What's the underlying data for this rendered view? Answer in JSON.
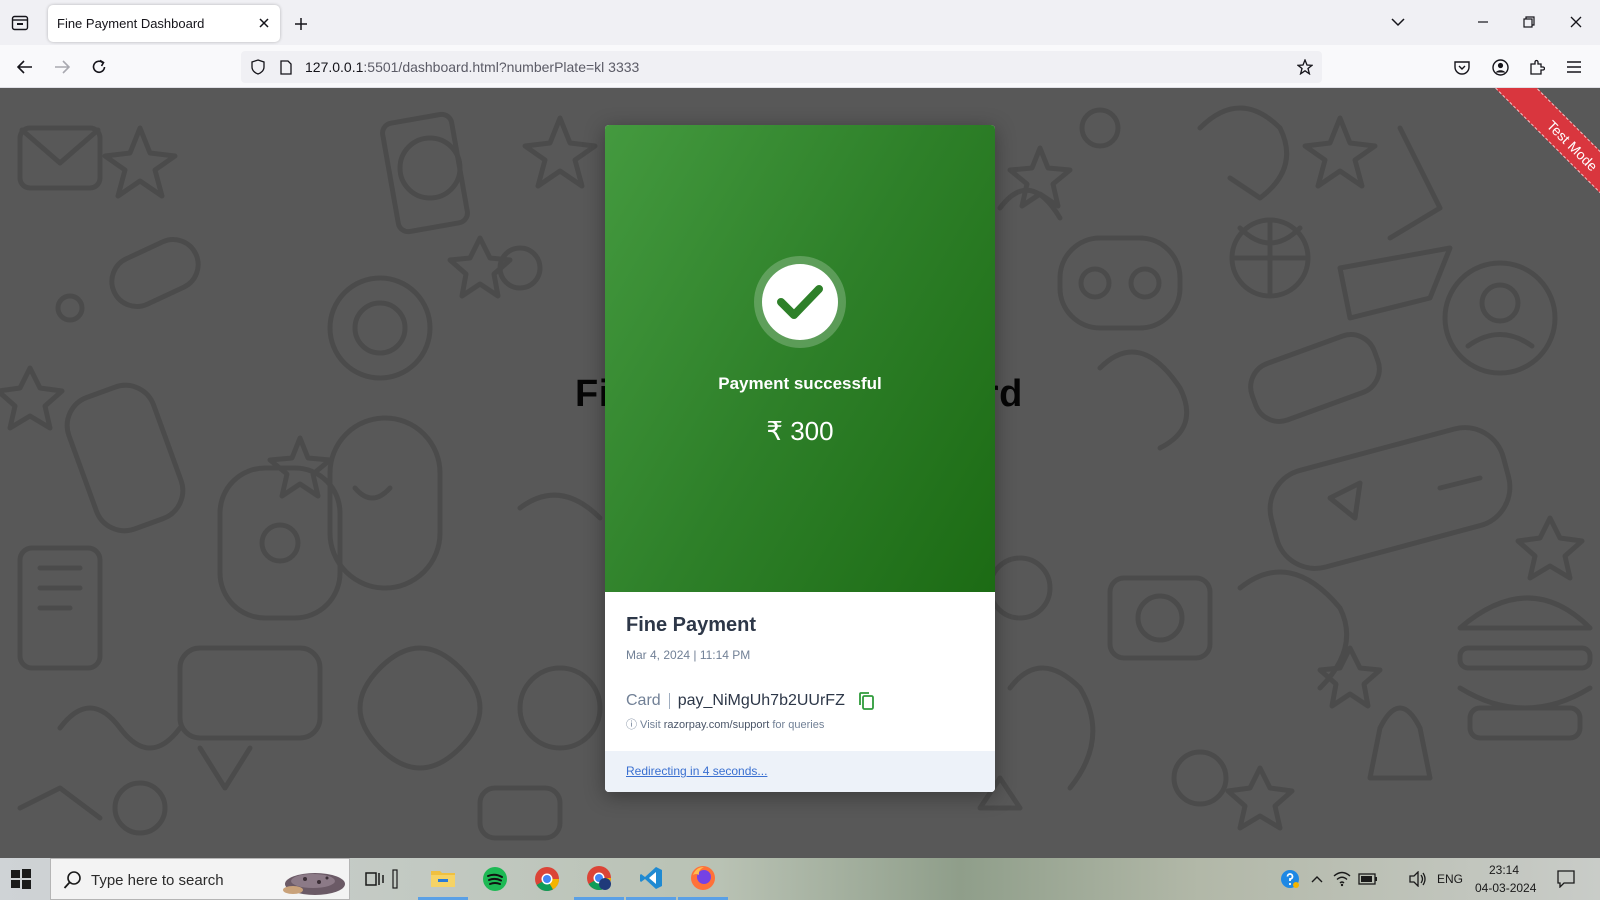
{
  "browser": {
    "tab_title": "Fine Payment Dashboard",
    "url_host": "127.0.0.1",
    "url_rest": ":5501/dashboard.html?numberPlate=kl 3333"
  },
  "page": {
    "heading_left": "Fi",
    "heading_right": "rd",
    "ribbon": "Test Mode"
  },
  "payment": {
    "status": "Payment successful",
    "amount": "₹ 300",
    "merchant": "Fine Payment",
    "date": "Mar 4, 2024 | 11:14 PM",
    "method_label": "Card",
    "payment_id": "pay_NiMgUh7b2UUrFZ",
    "support_prefix": "ⓘ Visit",
    "support_link": "razorpay.com/support",
    "support_suffix": "for queries",
    "redirect": "Redirecting in 4 seconds..."
  },
  "colors": {
    "success_green": "#2e8029",
    "ribbon_red": "#d9363e",
    "link_blue": "#3a70d1"
  },
  "taskbar": {
    "search_placeholder": "Type here to search",
    "language": "ENG",
    "time": "23:14",
    "date": "04-03-2024",
    "apps": [
      "task-view",
      "file-explorer",
      "spotify",
      "chrome",
      "chrome-profile",
      "vscode",
      "firefox"
    ]
  }
}
